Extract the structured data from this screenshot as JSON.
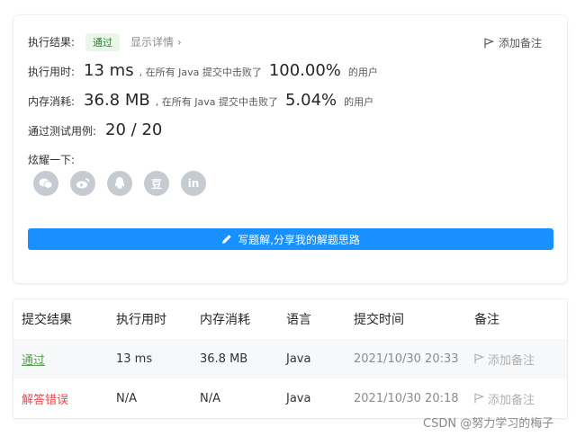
{
  "result": {
    "label": "执行结果:",
    "status": "通过",
    "details": "显示详情",
    "add_note": "添加备注"
  },
  "runtime": {
    "label": "执行用时:",
    "value": "13 ms",
    "beat_text": ", 在所有 Java 提交中击败了",
    "percent": "100.00%",
    "suffix": "的用户"
  },
  "memory": {
    "label": "内存消耗:",
    "value": "36.8 MB",
    "beat_text": ", 在所有 Java 提交中击败了",
    "percent": "5.04%",
    "suffix": "的用户"
  },
  "tests": {
    "label": "通过测试用例:",
    "value": "20 / 20"
  },
  "share": {
    "label": "炫耀一下:",
    "icons": [
      "wechat-icon",
      "weibo-icon",
      "qq-icon",
      "douban-icon",
      "linkedin-icon"
    ],
    "douban_glyph": "豆",
    "linkedin_glyph": "in"
  },
  "write_button": "写题解,分享我的解题思路",
  "table": {
    "headers": [
      "提交结果",
      "执行用时",
      "内存消耗",
      "语言",
      "提交时间",
      "备注"
    ],
    "rows": [
      {
        "result": "通过",
        "time": "13 ms",
        "memory": "36.8 MB",
        "lang": "Java",
        "submitted": "2021/10/30 20:33",
        "note": "添加备注"
      },
      {
        "result": "解答错误",
        "time": "N/A",
        "memory": "N/A",
        "lang": "Java",
        "submitted": "2021/10/30 20:18",
        "note": "添加备注"
      }
    ]
  },
  "watermark": "CSDN @努力学习的梅子",
  "colors": {
    "accent": "#1890ff",
    "success": "#52a04a",
    "error": "#e5484d"
  }
}
